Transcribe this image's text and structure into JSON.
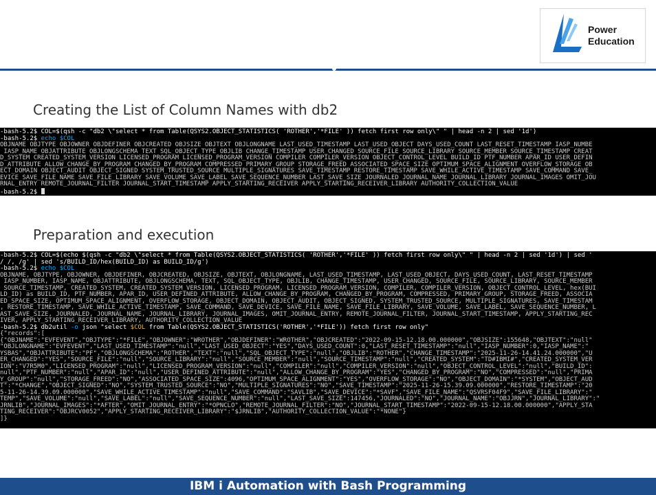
{
  "logo": {
    "line1": "Power",
    "line2": "Education",
    "colors": {
      "blue": "#1a6fc4",
      "light_blue": "#4aa3e8"
    }
  },
  "section1": {
    "title": "Creating the List of Column Names with db2"
  },
  "terminal1": {
    "line1": "-bash-5.2$ COL=$(qsh -c \"db2 \\\"select * from Table(QSYS2.OBJECT_STATISTICS( 'ROTHER','*FILE' )) fetch first row only\\\" \" | head -n 2 | sed '1d')",
    "line2_prompt": "-bash-5.2$ ",
    "line2_cmd": "echo $COL",
    "out1": "OBJNAME OBJTYPE OBJOWNER OBJDEFINER OBJCREATED OBJSIZE OBJTEXT OBJLONGNAME LAST_USED_TIMESTAMP LAST_USED_OBJECT DAYS_USED_COUNT LAST_RESET_TIMESTAMP IASP_NUMBE",
    "out2": " IASP_NAME OBJATTRIBUTE OBJLONGSCHEMA TEXT SQL_OBJECT_TYPE OBJLIB CHANGE_TIMESTAMP USER_CHANGED SOURCE_FILE SOURCE_LIBRARY SOURCE_MEMBER SOURCE_TIMESTAMP CREAT",
    "out3": "D_SYSTEM CREATED_SYSTEM_VERSION LICENSED_PROGRAM LICENSED_PROGRAM_VERSION COMPILER COMPILER_VERSION OBJECT_CONTROL_LEVEL BUILD_ID PTF_NUMBER APAR_ID USER_DEFIN",
    "out4": "D_ATTRIBUTE ALLOW_CHANGE_BY_PROGRAM CHANGED_BY_PROGRAM COMPRESSED PRIMARY_GROUP STORAGE_FREED ASSOCIATED_SPACE_SIZE OPTIMUM_SPACE_ALIGNMENT OVERFLOW_STORAGE OB",
    "out5": "ECT_DOMAIN OBJECT_AUDIT OBJECT_SIGNED SYSTEM_TRUSTED_SOURCE MULTIPLE_SIGNATURES SAVE_TIMESTAMP RESTORE_TIMESTAMP SAVE_WHILE_ACTIVE_TIMESTAMP SAVE_COMMAND SAVE_",
    "out6": "EVICE SAVE_FILE_NAME SAVE_FILE_LIBRARY SAVE_VOLUME SAVE_LABEL SAVE_SEQUENCE_NUMBER LAST_SAVE_SIZE JOURNALED JOURNAL_NAME JOURNAL_LIBRARY JOURNAL_IMAGES OMIT_JOU",
    "out7": "RNAL_ENTRY REMOTE_JOURNAL_FILTER JOURNAL_START_TIMESTAMP APPLY_STARTING_RECEIVER APPLY_STARTING_RECEIVER_LIBRARY AUTHORITY_COLLECTION_VALUE",
    "last_prompt": "-bash-5.2$ "
  },
  "section2": {
    "title": "Preparation and execution"
  },
  "terminal2": {
    "l01": "-bash-5.2$ COL=$(echo $(qsh -c \"db2 \\\"select * from Table(QSYS2.OBJECT_STATISTICS( 'ROTHER','*FILE' )) fetch first row only\\\" \" | head -n 2 | sed '1d') | sed '",
    "l02": "/ /, /g' | sed 's/BUILD_ID/hex(BUILD_ID) as BUILD_ID/g')",
    "l03_prompt": "-bash-5.2$ ",
    "l03_cmd": "echo $COL",
    "l04": "OBJNAME, OBJTYPE, OBJOWNER, OBJDEFINER, OBJCREATED, OBJSIZE, OBJTEXT, OBJLONGNAME, LAST_USED_TIMESTAMP, LAST_USED_OBJECT, DAYS_USED_COUNT, LAST_RESET_TIMESTAMP",
    "l05": " IASP_NUMBER, IASP_NAME, OBJATTRIBUTE, OBJLONGSCHEMA, TEXT, SQL_OBJECT_TYPE, OBJLIB, CHANGE_TIMESTAMP, USER_CHANGED, SOURCE_FILE, SOURCE_LIBRARY, SOURCE_MEMBER",
    "l06": " SOURCE_TIMESTAMP, CREATED_SYSTEM, CREATED_SYSTEM_VERSION, LICENSED_PROGRAM, LICENSED_PROGRAM_VERSION, COMPILER, COMPILER_VERSION, OBJECT_CONTROL_LEVEL, hex(BUI",
    "l07": "LD_ID) as BUILD_ID, PTF_NUMBER, APAR_ID, USER_DEFINED_ATTRIBUTE, ALLOW_CHANGE_BY_PROGRAM, CHANGED_BY_PROGRAM, COMPRESSED, PRIMARY_GROUP, STORAGE_FREED, ASSOCIA",
    "l08": "ED_SPACE_SIZE, OPTIMUM_SPACE_ALIGNMENT, OVERFLOW_STORAGE, OBJECT_DOMAIN, OBJECT_AUDIT, OBJECT_SIGNED, SYSTEM_TRUSTED_SOURCE, MULTIPLE_SIGNATURES, SAVE_TIMESTAM",
    "l09": ", RESTORE_TIMESTAMP, SAVE_WHILE_ACTIVE_TIMESTAMP, SAVE_COMMAND, SAVE_DEVICE, SAVE_FILE_NAME, SAVE_FILE_LIBRARY, SAVE_VOLUME, SAVE_LABEL, SAVE_SEQUENCE_NUMBER, L",
    "l10": "AST_SAVE_SIZE, JOURNALED, JOURNAL_NAME, JOURNAL_LIBRARY, JOURNAL_IMAGES, OMIT_JOURNAL_ENTRY, REMOTE_JOURNAL_FILTER, JOURNAL_START_TIMESTAMP, APPLY_STARTING_REC",
    "l11": "IVER, APPLY_STARTING_RECEIVER_LIBRARY, AUTHORITY_COLLECTION_VALUE",
    "l12_prompt": "-bash-5.2$ db2util ",
    "l12_flag": "-o",
    "l12_mid": " json \"select ",
    "l12_var": "$COL",
    "l12_end": " from Table(QSYS2.OBJECT_STATISTICS('ROTHER','*FILE')) fetch first row only\"",
    "l13": "{\"records\":[",
    "l14": "{\"OBJNAME\":\"EVFEVENT\",\"OBJTYPE\":\"*FILE\",\"OBJOWNER\":\"WROTHER\",\"OBJDEFINER\":\"WROTHER\",\"OBJCREATED\":\"2022-09-15-12.18.00.000000\",\"OBJSIZE\":155648,\"OBJTEXT\":\"null\"",
    "l15": "\"OBJLONGNAME\":\"EVFEVENT\",\"LAST_USED_TIMESTAMP\":\"null\",\"LAST_USED_OBJECT\":\"YES\",\"DAYS_USED_COUNT\":0,\"LAST_RESET_TIMESTAMP\":\"null\",\"IASP_NUMBER\":0,\"IASP_NAME\":\"",
    "l16": "YSBAS\",\"OBJATTRIBUTE\":\"PF\",\"OBJLONGSCHEMA\":\"ROTHER\",\"TEXT\":\"null\",\"SQL_OBJECT_TYPE\":\"null\",\"OBJLIB\":\"ROTHER\",\"CHANGE_TIMESTAMP\":\"2025-11-26-14.41.24.000000\",\"U",
    "l17": "ER_CHANGED\":\"YES\",\"SOURCE_FILE\":\"null\",\"SOURCE_LIBRARY\":\"null\",\"SOURCE_MEMBER\":\"null\",\"SOURCE_TIMESTAMP\":\"null\",\"CREATED_SYSTEM\":\"TD#IBMI#\",\"CREATED_SYSTEM_VER",
    "l18": "ION\":\"V7R5M0\",\"LICENSED_PROGRAM\":\"null\",\"LICENSED_PROGRAM_VERSION\":\"null\",\"COMPILER\":\"null\",\"COMPILER_VERSION\":\"null\",\"OBJECT_CONTROL_LEVEL\":\"null\",\"BUILD_ID\":",
    "l19": "null\",\"PTF_NUMBER\":\"null\",\"APAR_ID\":\"null\",\"USER_DEFINED_ATTRIBUTE\":\"null\",\"ALLOW_CHANGE_BY_PROGRAM\":\"YES\",\"CHANGED_BY_PROGRAM\":\"NO\",\"COMPRESSED\":\"null\",\"PRIMA",
    "l20": "Y_GROUP\":\"null\",\"STORAGE_FREED\":\"NO\",\"ASSOCIATED_SPACE_SIZE\":4096,\"OPTIMUM_SPACE_ALIGNMENT\":\"YES\",\"OVERFLOW_STORAGE\":\"NO\",\"OBJECT_DOMAIN\":\"*SYSTEM\",\"OBJECT_AUD",
    "l21": "T\":\"*CHANGE\",\"OBJECT_SIGNED\":\"NO\",\"SYSTEM_TRUSTED_SOURCE\":\"NO\",\"MULTIPLE_SIGNATURES\":\"NO\",\"SAVE_TIMESTAMP\":\"2025-11-26-15.39.09.000000\",\"RESTORE_TIMESTAMP\":\"20",
    "l22": "5-11-26-14.39.09.000000\",\"SAVE_WHILE_ACTIVE_TIMESTAMP\":\"null\",\"SAVE_COMMAND\":\"SAVLIB\",\"SAVE_DEVICE\":\"*SAVF\",\"SAVE_FILE_NAME\":\"QSVRSF04F9\",\"SAVE_FILE_LIBRARY\":\"",
    "l23": "TEMP\",\"SAVE_VOLUME\":\"null\",\"SAVE_LABEL\":\"null\",\"SAVE_SEQUENCE_NUMBER\":\"null\",\"LAST_SAVE_SIZE\":147456,\"JOURNALED\":\"NO\",\"JOURNAL_NAME\":\"OBJJRN\",\"JOURNAL_LIBRARY\":\"",
    "l24": "JRNLIB\",\"JOURNAL_IMAGES\":\"*AFTER\",\"OMIT_JOURNAL_ENTRY\":\"*OPNCLO\",\"REMOTE_JOURNAL_FILTER\":\"NO\",\"JOURNAL_START_TIMESTAMP\":\"2022-09-15-12.18.00.000000\",\"APPLY_STA",
    "l25": "TING_RECEIVER\":\"OBJRCV0052\",\"APPLY_STARTING_RECEIVER_LIBRARY\":\"$JRNLIB\",\"AUTHORITY_COLLECTION_VALUE\":\"*NONE\"}",
    "l26": "]}"
  },
  "footer": {
    "title": "IBM i Automation with Bash Programming"
  }
}
